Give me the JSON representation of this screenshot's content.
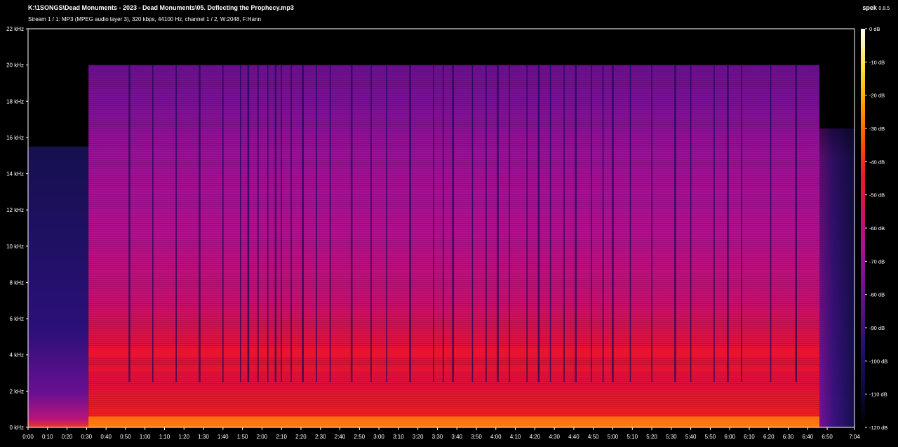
{
  "header": {
    "file_path": "K:\\1SONGS\\Dead Monuments  - 2023 - Dead Monuments\\05. Deflecting the Prophecy.mp3",
    "stream_info": "Stream 1 / 1: MP3 (MPEG audio layer 3), 320 kbps, 44100 Hz, channel 1 / 2, W:2048, F:Hann",
    "app_name": "spek",
    "app_version": "0.8.5"
  },
  "colors": {
    "background": "#000000",
    "axis": "#ffffff",
    "text": "#ffffff"
  },
  "chart_data": {
    "type": "heatmap",
    "title": "",
    "xlabel": "",
    "ylabel": "",
    "y_ticks": [
      "0 kHz",
      "2 kHz",
      "4 kHz",
      "6 kHz",
      "8 kHz",
      "10 kHz",
      "12 kHz",
      "14 kHz",
      "16 kHz",
      "18 kHz",
      "20 kHz",
      "22 kHz"
    ],
    "y_range_khz": [
      0,
      22
    ],
    "x_ticks": [
      "0:00",
      "0:10",
      "0:20",
      "0:30",
      "0:40",
      "0:50",
      "1:00",
      "1:10",
      "1:20",
      "1:30",
      "1:40",
      "1:50",
      "2:00",
      "2:10",
      "2:20",
      "2:30",
      "2:40",
      "2:50",
      "3:00",
      "3:10",
      "3:20",
      "3:30",
      "3:40",
      "3:50",
      "4:00",
      "4:10",
      "4:20",
      "4:30",
      "4:40",
      "4:50",
      "5:00",
      "5:10",
      "5:20",
      "5:30",
      "5:40",
      "5:50",
      "6:00",
      "6:10",
      "6:20",
      "6:30",
      "6:40",
      "6:50",
      "7:04"
    ],
    "x_range_seconds": [
      0,
      424
    ],
    "db_ticks": [
      "0 dB",
      "-10 dB",
      "-20 dB",
      "-30 dB",
      "-40 dB",
      "-50 dB",
      "-60 dB",
      "-70 dB",
      "-80 dB",
      "-90 dB",
      "-100 dB",
      "-110 dB",
      "-120 dB"
    ],
    "db_range": [
      -120,
      0
    ],
    "colormap": [
      "#000000",
      "#0a0a3a",
      "#1c0f6e",
      "#4a1280",
      "#7a1094",
      "#a8129a",
      "#d0125a",
      "#ee1a24",
      "#ff5a00",
      "#ffa800",
      "#ffe640",
      "#ffffff"
    ],
    "spectrum_segments": [
      {
        "start_s": 0,
        "end_s": 31,
        "top_khz": 15.5,
        "level": "quiet"
      },
      {
        "start_s": 31,
        "end_s": 406,
        "top_khz": 20.0,
        "level": "loud"
      },
      {
        "start_s": 406,
        "end_s": 424,
        "top_khz": 16.5,
        "level": "fade"
      }
    ],
    "dark_stripe_times_s": [
      52,
      64,
      76,
      88,
      100,
      109,
      113,
      118,
      123,
      127,
      130,
      135,
      141,
      148,
      155,
      166,
      176,
      184,
      196,
      208,
      213,
      218,
      228,
      235,
      241,
      247,
      256,
      262,
      268,
      275,
      281,
      289,
      295,
      300,
      309,
      320,
      332,
      340,
      352,
      359,
      366,
      381,
      394
    ]
  }
}
